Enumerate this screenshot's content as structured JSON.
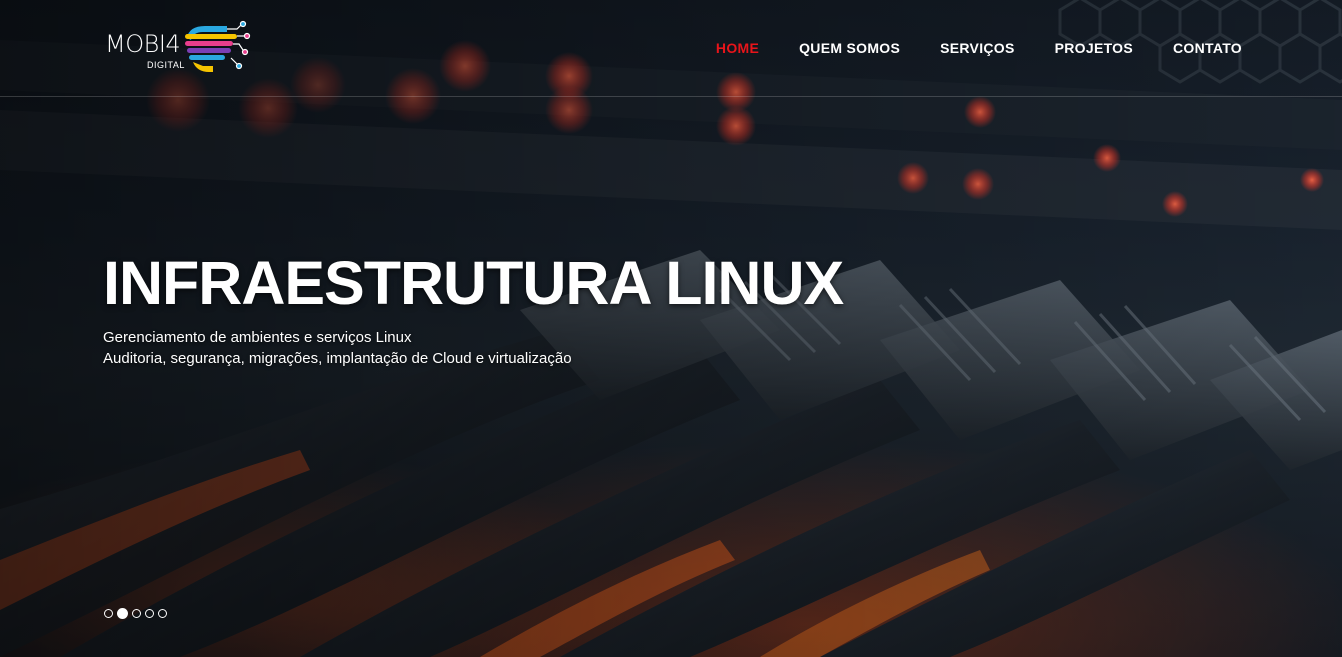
{
  "brand": {
    "name": "MOBI4",
    "sub": "DIGITAL",
    "colors": {
      "accent": "#e8141a",
      "logo_yellow": "#f5c400",
      "logo_blue": "#2aa8e0",
      "logo_pink": "#e83e8c",
      "logo_purple": "#7b3fb5"
    }
  },
  "nav": {
    "items": [
      {
        "label": "HOME",
        "active": true
      },
      {
        "label": "QUEM SOMOS"
      },
      {
        "label": "SERVIÇOS"
      },
      {
        "label": "PROJETOS"
      },
      {
        "label": "CONTATO"
      }
    ]
  },
  "hero": {
    "title": "INFRAESTRUTURA LINUX",
    "lines": [
      "Gerenciamento de ambientes e serviços Linux",
      "Auditoria, segurança, migrações, implantação de Cloud e virtualização"
    ],
    "slides_total": 5,
    "active_slide": 2
  }
}
